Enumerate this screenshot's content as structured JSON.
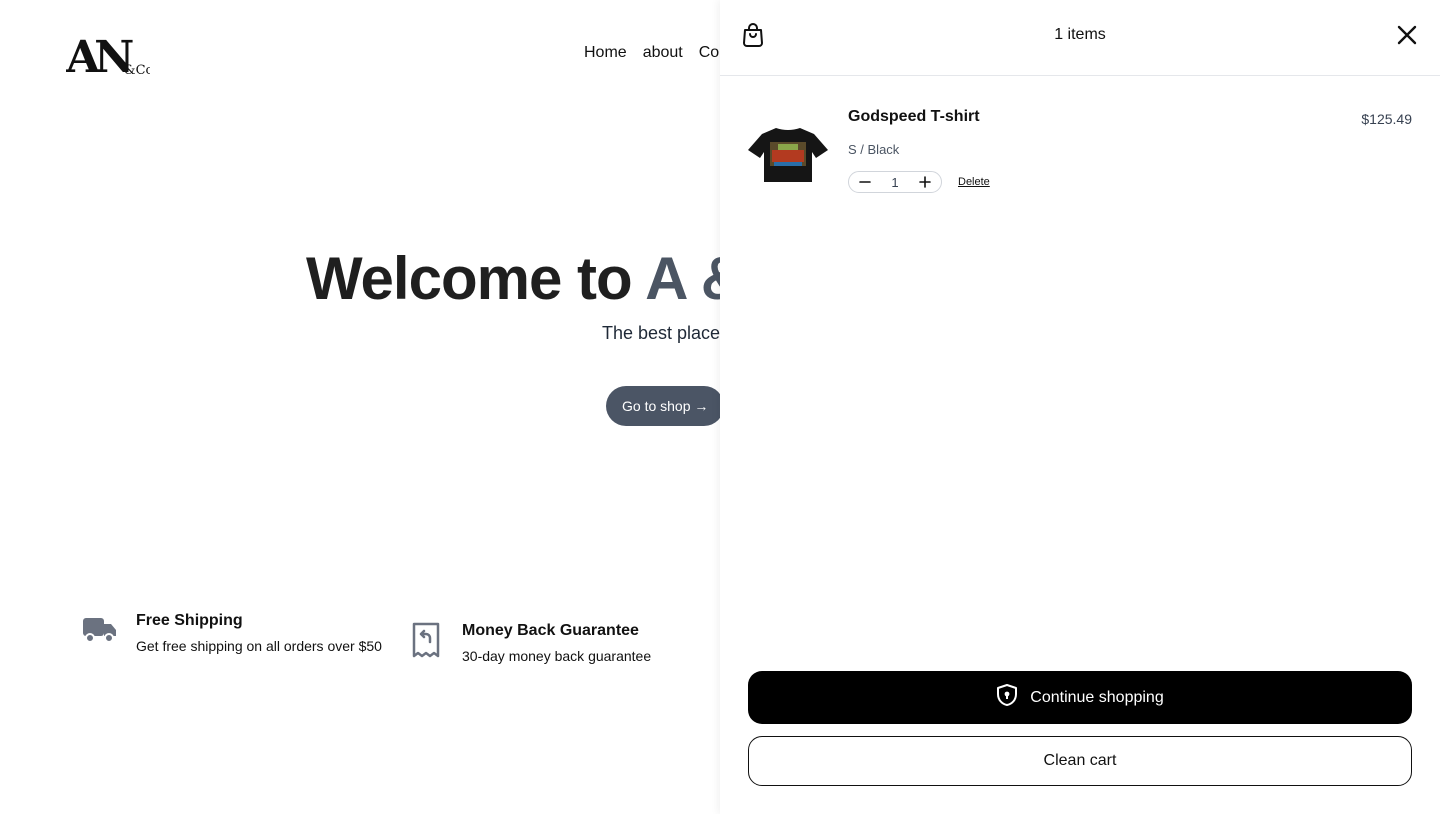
{
  "brand": {
    "logo_text": "AN",
    "logo_sub": "&Co."
  },
  "nav": {
    "items": [
      "Home",
      "about",
      "Co"
    ]
  },
  "hero": {
    "title_dark": "Welcome to ",
    "title_grey": "A &",
    "subtitle": "The best place",
    "cta_label": "Go to shop →"
  },
  "features": [
    {
      "icon": "truck-icon",
      "title": "Free Shipping",
      "text": "Get free shipping on all orders over $50"
    },
    {
      "icon": "receipt-refund-icon",
      "title": "Money Back Guarantee",
      "text": "30-day money back guarantee"
    }
  ],
  "cart": {
    "count_label": "1 items",
    "items": [
      {
        "name": "Godspeed T-shirt",
        "variant": "S / Black",
        "price": "$125.49",
        "quantity": "1",
        "delete_label": "Delete"
      }
    ],
    "continue_label": "Continue shopping",
    "clean_label": "Clean cart"
  },
  "colors": {
    "cta_bg": "#4b5565",
    "primary_btn": "#000000",
    "muted_text": "#4b5563"
  }
}
